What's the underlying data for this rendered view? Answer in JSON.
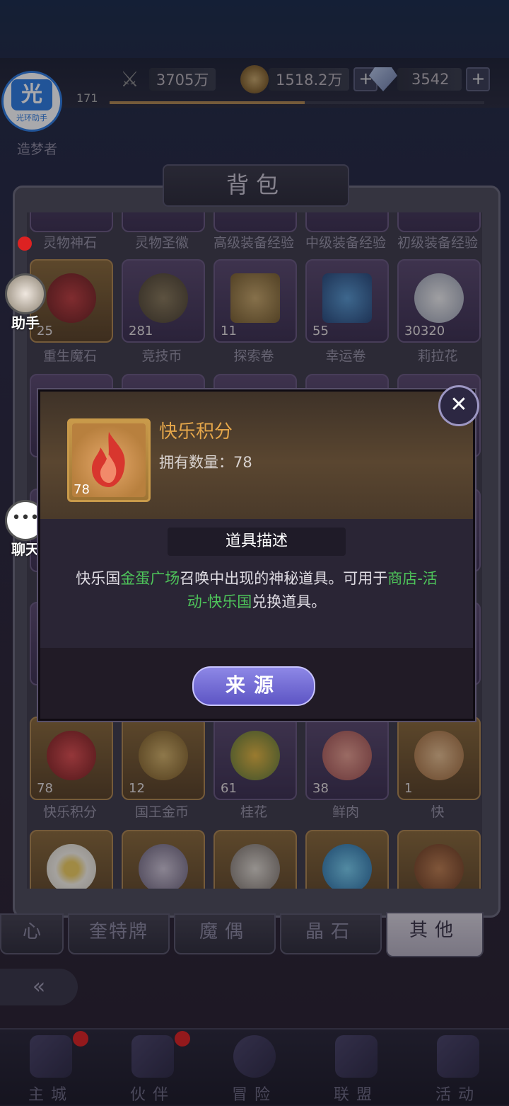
{
  "hud": {
    "power": "3705万",
    "gold": "1518.2万",
    "diamonds": "3542",
    "level": "171",
    "rank_title": "造梦者",
    "assistant_badge": "光",
    "assistant_badge_sub": "光环助手"
  },
  "bag": {
    "title": "背包",
    "top_labels": [
      "灵物神石",
      "灵物圣徽",
      "高级装备经验",
      "中级装备经验",
      "初级装备经验"
    ],
    "row2": [
      {
        "count": "25",
        "label": "重生魔石"
      },
      {
        "count": "281",
        "label": "竞技币"
      },
      {
        "count": "11",
        "label": "探索卷"
      },
      {
        "count": "55",
        "label": "幸运卷"
      },
      {
        "count": "30320",
        "label": "莉拉花"
      }
    ],
    "row6": [
      {
        "count": "78",
        "label": "快乐积分"
      },
      {
        "count": "12",
        "label": "国王金币"
      },
      {
        "count": "61",
        "label": "桂花"
      },
      {
        "count": "38",
        "label": "鲜肉"
      },
      {
        "count": "1",
        "label": "快"
      }
    ]
  },
  "tabs": [
    "心",
    "奎特牌",
    "魔偶",
    "晶石",
    "其他"
  ],
  "side_buttons": {
    "helper": "助手",
    "chat": "聊天"
  },
  "nav": [
    "主城",
    "伙伴",
    "冒险",
    "联盟",
    "活动"
  ],
  "modal": {
    "item_name": "快乐积分",
    "own_label": "拥有数量：",
    "own_value": "78",
    "frame_count": "78",
    "section_title": "道具描述",
    "desc_1": "快乐国",
    "desc_2": "金蛋广场",
    "desc_3": "召唤中出现的神秘道具。可用于",
    "desc_4": "商店-活动-快乐国",
    "desc_5": "兑换道具。",
    "source_button": "来源"
  }
}
